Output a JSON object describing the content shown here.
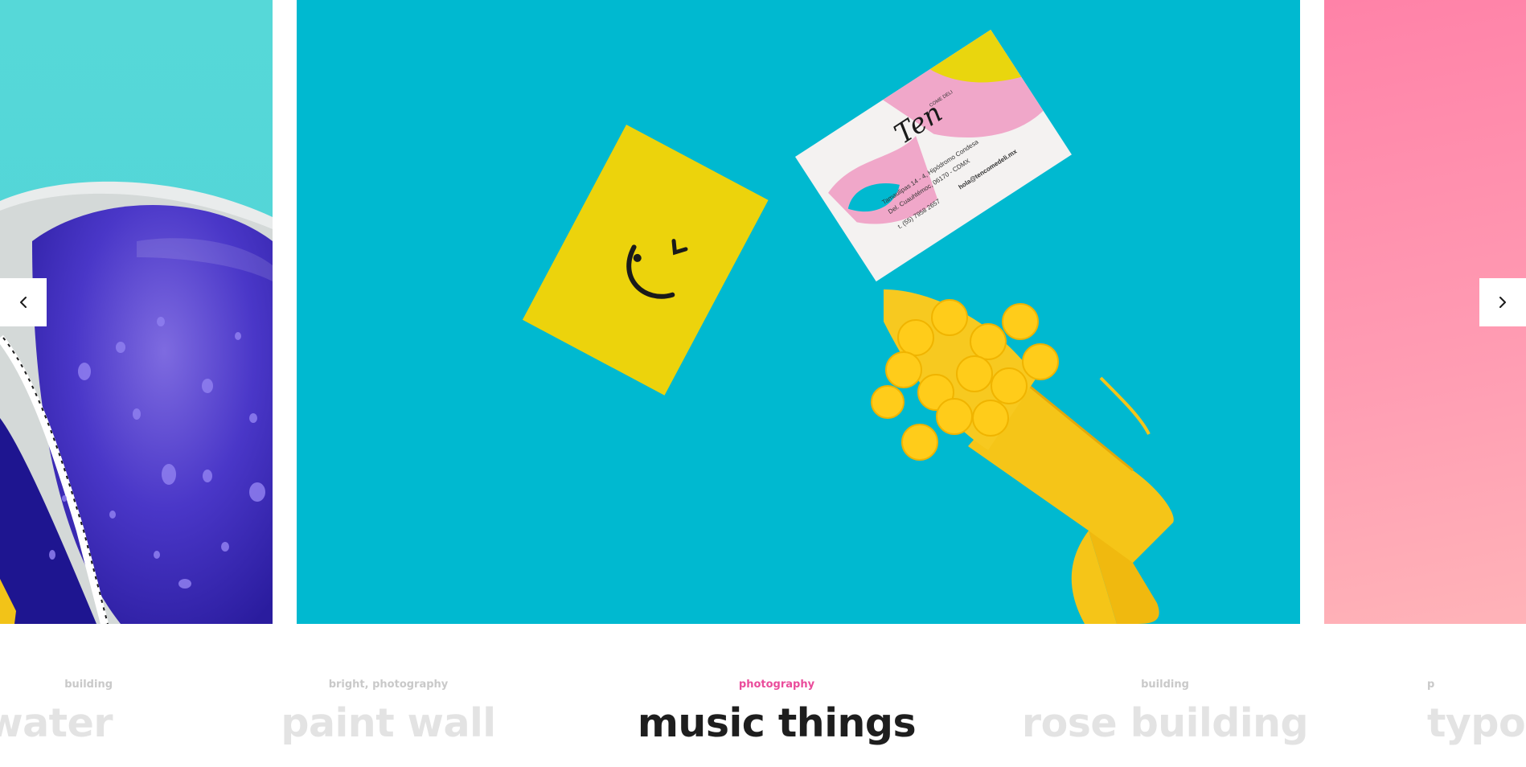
{
  "slider": {
    "slides": [
      {
        "category": "building",
        "title": "water",
        "state": "side",
        "image": "blue-ball-with-water-drops"
      },
      {
        "category": "bright, photography",
        "title": "paint wall",
        "state": "side",
        "image": "business-cards-with-paint-brush"
      },
      {
        "category": "photography",
        "title": "music things",
        "state": "active",
        "image": "business-cards-with-paint-brush"
      },
      {
        "category": "building",
        "title": "rose building",
        "state": "side",
        "image": "pink-gradient"
      },
      {
        "category": "p",
        "title": "typo",
        "state": "side",
        "image": "pink-gradient"
      }
    ],
    "prev_icon": "chevron-left-icon",
    "next_icon": "chevron-right-icon"
  },
  "card_text": {
    "script_logo": "Ten",
    "subtitle": "COME DELI",
    "address_1": "Tamaulipas 14 - 4, Hipódromo Condesa",
    "address_2": "Del. Cuauhtémoc, 06170 - CDMX",
    "phone": "t. (55) 7958 2657",
    "email": "hola@tencomedeli.mx"
  },
  "colors": {
    "accent": "#ea4c9b",
    "title_active": "#1e1e1e",
    "title_inactive": "#e3e3e3",
    "center_bg": "#00b9d0",
    "left_bg": "#56d8d8",
    "right_bg": "#ff8aa9",
    "yellow": "#f5c518"
  }
}
